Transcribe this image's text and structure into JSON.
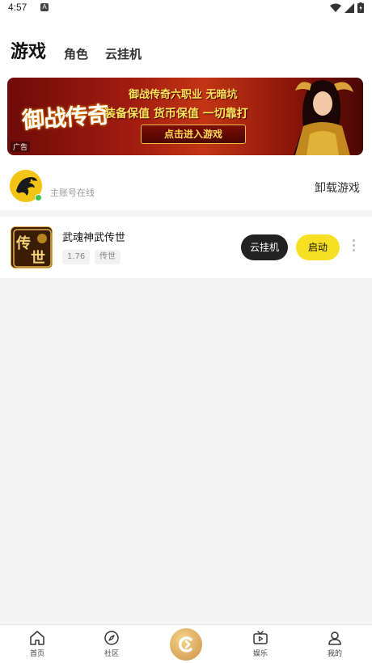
{
  "status_bar": {
    "time": "4:57",
    "notification_icon": "a-icon"
  },
  "header": {
    "tabs": [
      {
        "label": "游戏",
        "active": true
      },
      {
        "label": "角色",
        "active": false
      },
      {
        "label": "云挂机",
        "active": false
      }
    ]
  },
  "ad": {
    "logo_text": "御战传奇",
    "line1": "御战传奇六职业 无暗坑",
    "line2": "装备保值 货币保值 一切靠打",
    "cta": "点击进入游戏",
    "tag": "广告"
  },
  "account": {
    "status": "主账号在线",
    "uninstall_label": "卸载游戏"
  },
  "game": {
    "title": "武魂神武传世",
    "version": "1.76",
    "genre": "传世",
    "cloud_button": "云挂机",
    "start_button": "启动",
    "icon_text": "传世"
  },
  "bottom_nav": {
    "items": [
      {
        "label": "首页",
        "icon": "home-icon"
      },
      {
        "label": "社区",
        "icon": "compass-icon"
      },
      {
        "label": "",
        "icon": "app-logo-icon"
      },
      {
        "label": "娱乐",
        "icon": "tv-icon"
      },
      {
        "label": "我的",
        "icon": "person-icon"
      }
    ]
  },
  "colors": {
    "accent_yellow": "#f7e024",
    "dark_button": "#222222",
    "online_green": "#39c64a"
  }
}
